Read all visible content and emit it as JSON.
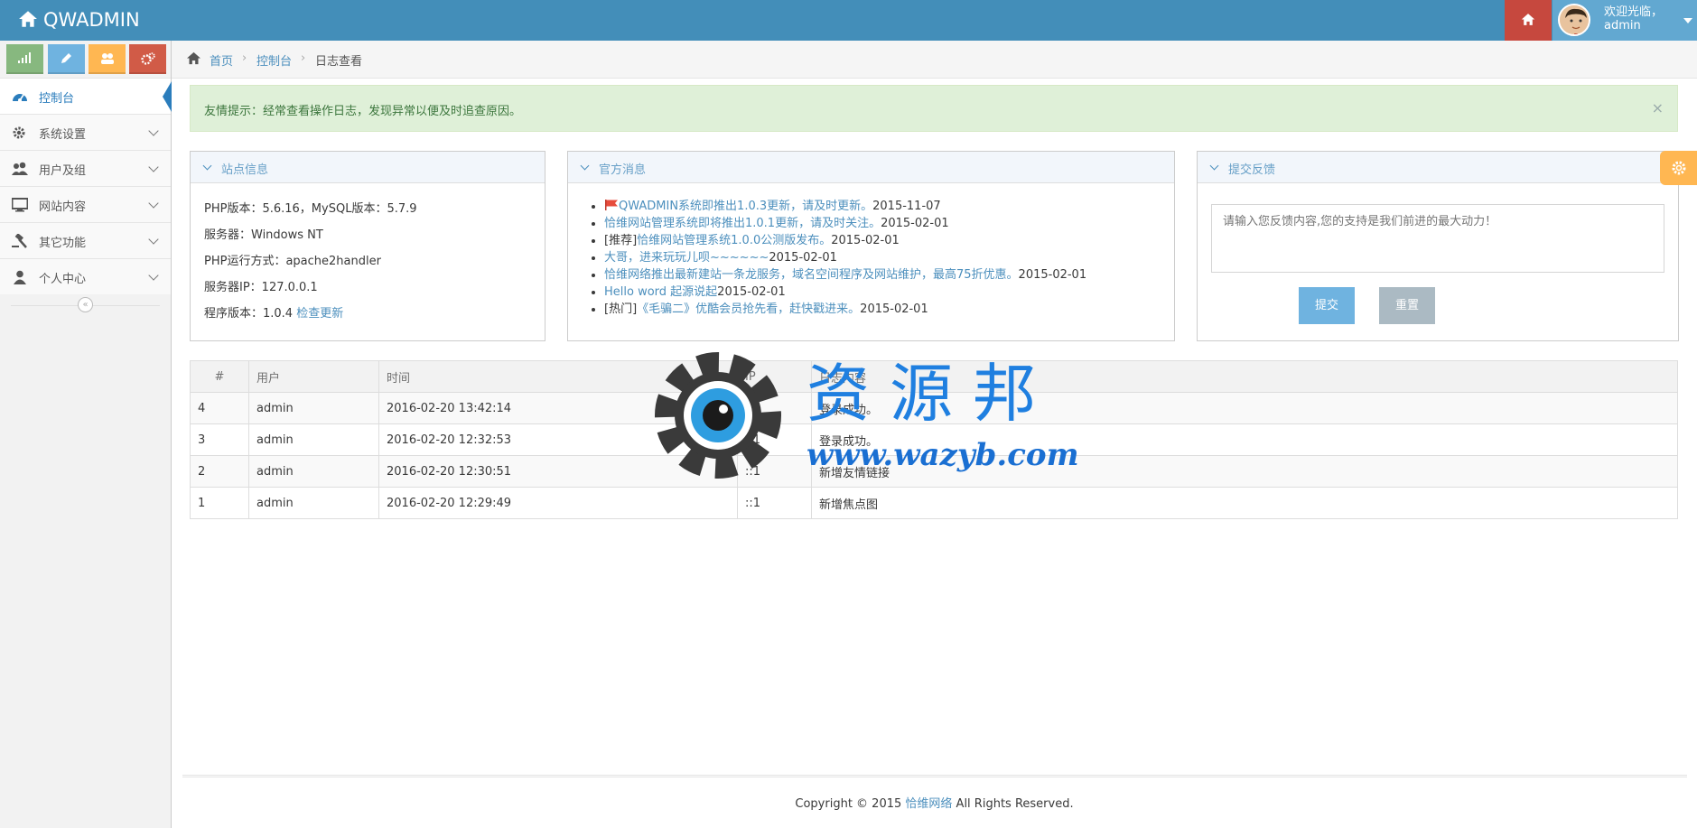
{
  "colors": {
    "navbar": "#438eb9",
    "accent": "#2b7dbc",
    "danger": "#c6483e",
    "warning": "#ffb752",
    "success": "#87b87f",
    "info": "#6fb3e0"
  },
  "navbar": {
    "brand": "QWADMIN",
    "user_greeting": "欢迎光临，",
    "user_name": "admin",
    "icons": [
      "home-icon",
      "avatar",
      "caret-down-icon"
    ]
  },
  "shortcuts": [
    {
      "icon": "signal-icon",
      "color": "#87b87f"
    },
    {
      "icon": "pencil-icon",
      "color": "#6fb3e0"
    },
    {
      "icon": "group-icon",
      "color": "#ffb752"
    },
    {
      "icon": "cogs-icon",
      "color": "#d15b47"
    }
  ],
  "sidebar": {
    "items": [
      {
        "label": "控制台",
        "icon": "dashboard-icon",
        "active": true
      },
      {
        "label": "系统设置",
        "icon": "gear-icon"
      },
      {
        "label": "用户及组",
        "icon": "users-icon"
      },
      {
        "label": "网站内容",
        "icon": "desktop-icon"
      },
      {
        "label": "其它功能",
        "icon": "gavel-icon"
      },
      {
        "label": "个人中心",
        "icon": "user-icon"
      }
    ],
    "collapse_glyph": "«"
  },
  "breadcrumb": {
    "home": "首页",
    "parent": "控制台",
    "current": "日志查看",
    "sep": "›"
  },
  "alert": {
    "text": "友情提示：经常查看操作日志，发现异常以便及时追查原因。",
    "close": "×"
  },
  "site_info": {
    "title": "站点信息",
    "lines": [
      "PHP版本：5.6.16，MySQL版本：5.7.9",
      "服务器：Windows NT",
      "PHP运行方式：apache2handler",
      "服务器IP：127.0.0.1",
      "程序版本：1.0.4"
    ],
    "check_update": "检查更新"
  },
  "official_news": {
    "title": "官方消息",
    "items": [
      {
        "prefix": "",
        "title": "QWADMIN系统即推出1.0.3更新，请及时更新。",
        "date": "2015-11-07",
        "flag": true
      },
      {
        "prefix": "",
        "title": "恰维网站管理系统即将推出1.0.1更新，请及时关注。",
        "date": "2015-02-01"
      },
      {
        "prefix": "[推荐]",
        "title": "恰维网站管理系统1.0.0公测版发布。",
        "date": "2015-02-01"
      },
      {
        "prefix": "",
        "title": "大哥，进来玩玩儿呗~~~~~~",
        "date": "2015-02-01"
      },
      {
        "prefix": "",
        "title": "恰维网络推出最新建站一条龙服务，域名空间程序及网站维护，最高75折优惠。",
        "date": "2015-02-01"
      },
      {
        "prefix": "",
        "title": "Hello word 起源说起",
        "date": "2015-02-01"
      },
      {
        "prefix": "[热门]",
        "title": "《毛骗二》优酷会员抢先看，赶快戳进来。",
        "date": "2015-02-01"
      }
    ]
  },
  "feedback": {
    "title": "提交反馈",
    "placeholder": "请输入您反馈内容,您的支持是我们前进的最大动力！",
    "submit": "提交",
    "reset": "重置"
  },
  "log_table": {
    "columns": [
      "#",
      "用户",
      "时间",
      "IP",
      "日志内容"
    ],
    "rows": [
      [
        "4",
        "admin",
        "2016-02-20 13:42:14",
        "::1",
        "登录成功。"
      ],
      [
        "3",
        "admin",
        "2016-02-20 12:32:53",
        "::1",
        "登录成功。"
      ],
      [
        "2",
        "admin",
        "2016-02-20 12:30:51",
        "::1",
        "新增友情链接"
      ],
      [
        "1",
        "admin",
        "2016-02-20 12:29:49",
        "::1",
        "新增焦点图"
      ]
    ]
  },
  "watermark": {
    "text": "资源邦",
    "url": "www.wazyb.com"
  },
  "footer": {
    "prefix": "Copyright © 2015 ",
    "link": "恰维网络",
    "suffix": " All Rights Reserved."
  }
}
